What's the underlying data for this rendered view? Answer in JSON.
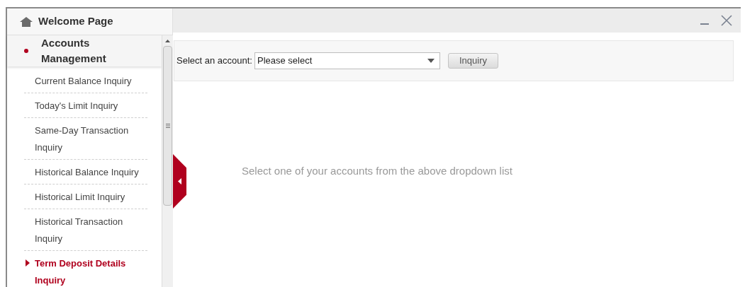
{
  "sidebar": {
    "home": {
      "label": "Welcome Page"
    },
    "section": {
      "title": "Accounts Management",
      "expanded": true
    },
    "items": [
      {
        "label": "Current Balance Inquiry",
        "selected": false
      },
      {
        "label": "Today's Limit Inquiry",
        "selected": false
      },
      {
        "label": "Same-Day Transaction Inquiry",
        "selected": false
      },
      {
        "label": "Historical Balance Inquiry",
        "selected": false
      },
      {
        "label": "Historical Limit Inquiry",
        "selected": false
      },
      {
        "label": "Historical Transaction Inquiry",
        "selected": false
      },
      {
        "label": "Term Deposit Details Inquiry",
        "selected": true
      }
    ]
  },
  "toolbar": {
    "label": "Select an account:",
    "select": {
      "value": "Please select"
    },
    "button": "Inquiry"
  },
  "message": "Select one of your accounts from the above dropdown list"
}
